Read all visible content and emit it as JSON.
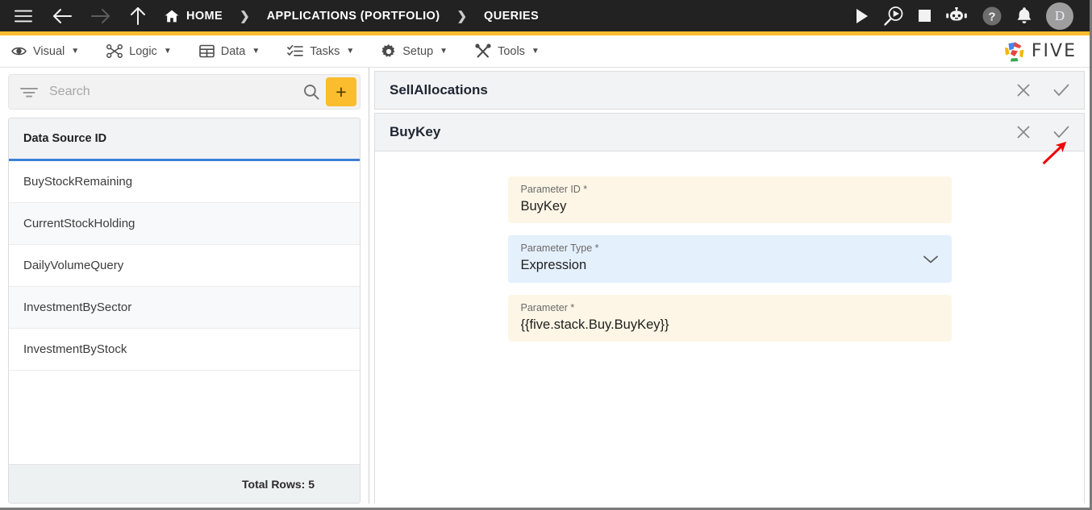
{
  "topbar": {
    "menu_icon": "hamburger-icon",
    "back_icon": "arrow-left-icon",
    "forward_icon": "arrow-right-icon",
    "up_icon": "arrow-up-icon",
    "breadcrumbs": [
      {
        "label": "HOME",
        "icon": "home-icon"
      },
      {
        "label": "APPLICATIONS (PORTFOLIO)",
        "icon": ""
      },
      {
        "label": "QUERIES",
        "icon": ""
      }
    ],
    "separator": "❯",
    "actions": [
      {
        "name": "run-icon",
        "title": "Run"
      },
      {
        "name": "debug-icon",
        "title": "Debug"
      },
      {
        "name": "stop-icon",
        "title": "Stop"
      },
      {
        "name": "chatbot-icon",
        "title": "Assistant"
      },
      {
        "name": "help-icon",
        "title": "Help"
      },
      {
        "name": "notifications-bell-icon",
        "title": "Notifications"
      }
    ],
    "avatar_initial": "D"
  },
  "menubar": {
    "items": [
      {
        "label": "Visual",
        "icon": "eye-icon",
        "caret": "▼"
      },
      {
        "label": "Logic",
        "icon": "nodes-icon",
        "caret": "▼"
      },
      {
        "label": "Data",
        "icon": "table-icon",
        "caret": "▼"
      },
      {
        "label": "Tasks",
        "icon": "checklist-icon",
        "caret": "▼"
      },
      {
        "label": "Setup",
        "icon": "gear-icon",
        "caret": "▼"
      },
      {
        "label": "Tools",
        "icon": "tools-icon",
        "caret": "▼"
      }
    ],
    "brand": {
      "text": "FIVE",
      "logo": "five-pinwheel-logo"
    }
  },
  "left_pane": {
    "search": {
      "placeholder": "Search",
      "value": "",
      "filter_icon": "filter-icon",
      "search_icon": "search-icon"
    },
    "add_button_label": "+",
    "grid": {
      "column_header": "Data Source ID",
      "rows": [
        "BuyStockRemaining",
        "CurrentStockHolding",
        "DailyVolumeQuery",
        "InvestmentBySector",
        "InvestmentByStock"
      ],
      "footer": "Total Rows: 5"
    }
  },
  "right_pane": {
    "panels": [
      {
        "title": "SellAllocations",
        "close_icon": "close-icon",
        "confirm_icon": "check-icon"
      },
      {
        "title": "BuyKey",
        "close_icon": "close-icon",
        "confirm_icon": "check-icon"
      }
    ],
    "form": {
      "fields": [
        {
          "label": "Parameter ID *",
          "value": "BuyKey",
          "style": "cream",
          "control": "text"
        },
        {
          "label": "Parameter Type *",
          "value": "Expression",
          "style": "blue",
          "control": "select",
          "chevron": "chevron-down-icon"
        },
        {
          "label": "Parameter *",
          "value": "{{five.stack.Buy.BuyKey}}",
          "style": "cream",
          "control": "text"
        }
      ]
    }
  },
  "annotation": {
    "type": "arrow",
    "color": "#f00000",
    "points_to": "buykey-confirm-check-icon"
  },
  "colors": {
    "topbar_bg": "#222222",
    "accent_yellow": "#fbbc2e",
    "header_underline_blue": "#3a7fd5",
    "field_cream": "#fdf6e6",
    "field_blue": "#e4f0fc",
    "annotation_red": "#f00000"
  }
}
